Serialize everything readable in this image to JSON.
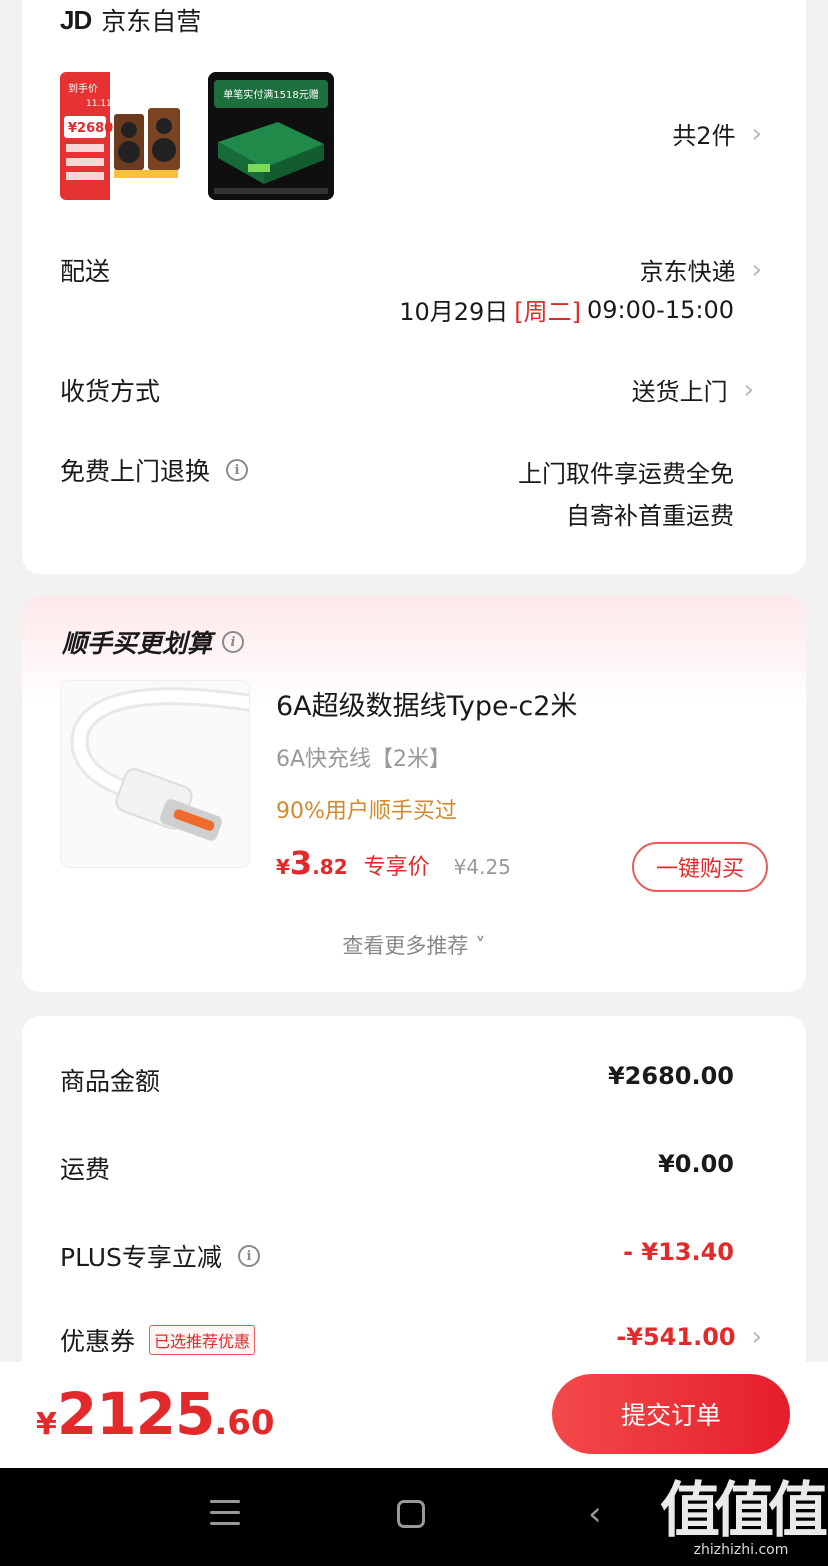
{
  "shop": {
    "logo": "JD",
    "name": "京东自营",
    "item_count": "共2件",
    "thumb1": {
      "badge": "11.11",
      "line1": "到手价",
      "price": "¥2680"
    },
    "thumb2": {
      "banner": "单笔实付满1518元赠"
    }
  },
  "delivery": {
    "label": "配送",
    "carrier": "京东快递",
    "date": "10月29日",
    "weekday": "[周二]",
    "time": "09:00-15:00"
  },
  "receive": {
    "label": "收货方式",
    "value": "送货上门"
  },
  "returns": {
    "label": "免费上门退换",
    "line1": "上门取件享运费全免",
    "line2": "自寄补首重运费"
  },
  "recommend": {
    "title": "顺手买更划算",
    "product_name": "6A超级数据线Type-c2米",
    "product_spec": "6A快充线【2米】",
    "hint": "90%用户顺手买过",
    "price_symbol": "¥",
    "price_int": "3",
    "price_dec": ".82",
    "price_tag": "专享价",
    "price_old": "¥4.25",
    "buy_button": "一键购买",
    "more": "查看更多推荐 ˅"
  },
  "pricing": {
    "goods": {
      "label": "商品金额",
      "value": "¥2680.00"
    },
    "shipping": {
      "label": "运费",
      "value": "¥0.00"
    },
    "plus": {
      "label": "PLUS专享立减",
      "value": "- ¥13.40"
    },
    "coupon": {
      "label": "优惠券",
      "badge": "已选推荐优惠",
      "value": "-¥541.00"
    }
  },
  "footer": {
    "total_symbol": "¥",
    "total_int": "2125",
    "total_dec": ".60",
    "submit": "提交订单"
  },
  "watermark": {
    "big": "值值值",
    "small": "zhizhizhi.com"
  },
  "colors": {
    "accent": "#e22a2a",
    "hint": "#d4892c",
    "background": "#f2f2f2"
  }
}
